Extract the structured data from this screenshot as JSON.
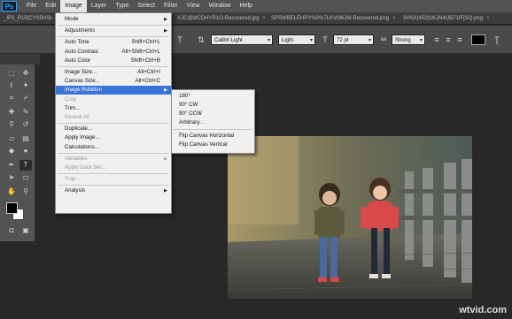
{
  "app": {
    "logo": "Ps"
  },
  "menubar": [
    {
      "label": "File"
    },
    {
      "label": "Edit"
    },
    {
      "label": "Image",
      "active": true
    },
    {
      "label": "Layer"
    },
    {
      "label": "Type"
    },
    {
      "label": "Select"
    },
    {
      "label": "Filter"
    },
    {
      "label": "View"
    },
    {
      "label": "Window"
    },
    {
      "label": "Help"
    }
  ],
  "doc_tabs": [
    {
      "label": "_IP3_R15|CYS5HSI-"
    },
    {
      "label": "XJC@MCDHYR1O-Recovered.jpg"
    },
    {
      "label": "SPSWBELEHPY%0%7LKVI96JM-Recovered.png"
    },
    {
      "label": "3VNX|452|UKJN4UB71IF|SQ.png"
    }
  ],
  "options": {
    "font_family": "Calibri Light",
    "font_style": "Light",
    "font_size": "72 pt",
    "antialias": "Strong",
    "text_color": "#000000"
  },
  "image_menu": {
    "items": [
      {
        "label": "Mode",
        "shortcut": "",
        "submenu": true,
        "disabled": false
      },
      {
        "sep": true
      },
      {
        "label": "Adjustments",
        "shortcut": "",
        "submenu": true,
        "disabled": false
      },
      {
        "sep": true
      },
      {
        "label": "Auto Tone",
        "shortcut": "Shift+Ctrl+L",
        "disabled": false
      },
      {
        "label": "Auto Contrast",
        "shortcut": "Alt+Shift+Ctrl+L",
        "disabled": false
      },
      {
        "label": "Auto Color",
        "shortcut": "Shift+Ctrl+B",
        "disabled": false
      },
      {
        "sep": true
      },
      {
        "label": "Image Size...",
        "shortcut": "Alt+Ctrl+I",
        "disabled": false
      },
      {
        "label": "Canvas Size...",
        "shortcut": "Alt+Ctrl+C",
        "disabled": false
      },
      {
        "label": "Image Rotation",
        "shortcut": "",
        "submenu": true,
        "hover": true,
        "disabled": false
      },
      {
        "label": "Crop",
        "shortcut": "",
        "disabled": true
      },
      {
        "label": "Trim...",
        "shortcut": "",
        "disabled": false
      },
      {
        "label": "Reveal All",
        "shortcut": "",
        "disabled": true
      },
      {
        "sep": true
      },
      {
        "label": "Duplicate...",
        "shortcut": "",
        "disabled": false
      },
      {
        "label": "Apply Image...",
        "shortcut": "",
        "disabled": false
      },
      {
        "label": "Calculations...",
        "shortcut": "",
        "disabled": false
      },
      {
        "sep": true
      },
      {
        "label": "Variables",
        "shortcut": "",
        "submenu": true,
        "disabled": true
      },
      {
        "label": "Apply Data Set...",
        "shortcut": "",
        "disabled": true
      },
      {
        "sep": true
      },
      {
        "label": "Trap...",
        "shortcut": "",
        "disabled": true
      },
      {
        "sep": true
      },
      {
        "label": "Analysis",
        "shortcut": "",
        "submenu": true,
        "disabled": false
      }
    ]
  },
  "rotation_submenu": {
    "items": [
      {
        "label": "180°"
      },
      {
        "label": "90° CW"
      },
      {
        "label": "90° CCW"
      },
      {
        "label": "Arbitrary..."
      },
      {
        "sep": true
      },
      {
        "label": "Flip Canvas Horizontal"
      },
      {
        "label": "Flip Canvas Vertical"
      }
    ]
  },
  "watermark": "wtvid.com"
}
